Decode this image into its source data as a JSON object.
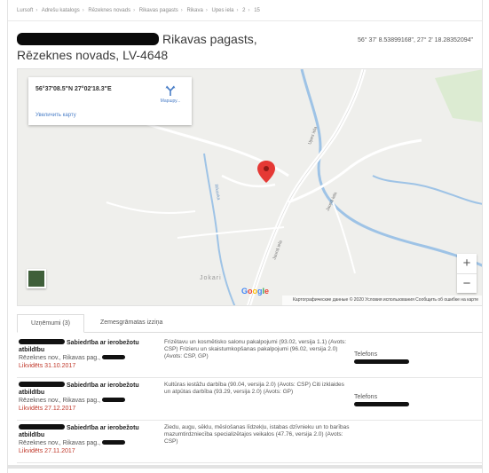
{
  "breadcrumb": [
    "Lursoft",
    "Adrešu katalogs",
    "Rēzeknes novads",
    "Rikavas pagasts",
    "Rikava",
    "Upes iela",
    "2",
    "15"
  ],
  "title": {
    "line1": "Rikavas pagasts,",
    "line2": "Rēzeknes novads, LV-4648"
  },
  "coordinates": "56° 37' 8.53899168\", 27° 2' 18.28352094\"",
  "map": {
    "info": {
      "latlon": "56°37'08.5\"N 27°02'18.3\"E",
      "directions": "Маршру...",
      "larger_map": "Увеличить карту"
    },
    "zoom_in": "+",
    "zoom_out": "−",
    "place_label": "Jokari",
    "google": [
      "G",
      "o",
      "o",
      "g",
      "l",
      "e"
    ],
    "google_colors": [
      "#4285f4",
      "#ea4335",
      "#fbbc05",
      "#4285f4",
      "#34a853",
      "#ea4335"
    ],
    "attribution": [
      "Картографические данные © 2020",
      "Условия использования",
      "Сообщить об ошибке на карте"
    ],
    "road_labels": [
      "Upes iela",
      "Jaunā iela",
      "Jaunā iela",
      "Rikavka"
    ],
    "marker_color": "#e53935"
  },
  "tabs": [
    {
      "label": "Uzņēmumi (3)",
      "active": true
    },
    {
      "label": "Zemesgrāmatas izziņa",
      "active": false
    }
  ],
  "rows": [
    {
      "name": "Sabiedrība ar ierobežotu atbildību",
      "address": "Rēzeknes nov., Rikavas pag.,",
      "date": "Likvidēts 31.10.2017",
      "activity": "Frizētavu un kosmētisko salonu pakalpojumi (93.02, versija 1.1) (Avots: CSP) Frizieru un skaistumkopšanas pakalpojumi (96.02, versija 2.0) (Avots: CSP, GP)",
      "phone": "Telefons"
    },
    {
      "name": "Sabiedrība ar ierobežotu atbildību",
      "address": "Rēzeknes nov., Rikavas pag.,",
      "date": "Likvidēts 27.12.2017",
      "activity": "Kultūras iestāžu darbība (90.04, versija 2.0) (Avots: CSP) Citi izklaides un atpūtas darbība (93.29, versija 2.0) (Avots: GP)",
      "phone": "Telefons"
    },
    {
      "name": "Sabiedrība ar ierobežotu atbildību",
      "address": "Rēzeknes nov., Rikavas pag.,",
      "date": "Likvidēts 27.11.2017",
      "activity": "Ziedu, augu, sēklu, mēslošanas līdzekļu, istabas dzīvnieku un to barības mazumtirdzniecība specializētajos veikalos (47.76, versija 2.0) (Avots: CSP)",
      "phone": ""
    }
  ]
}
